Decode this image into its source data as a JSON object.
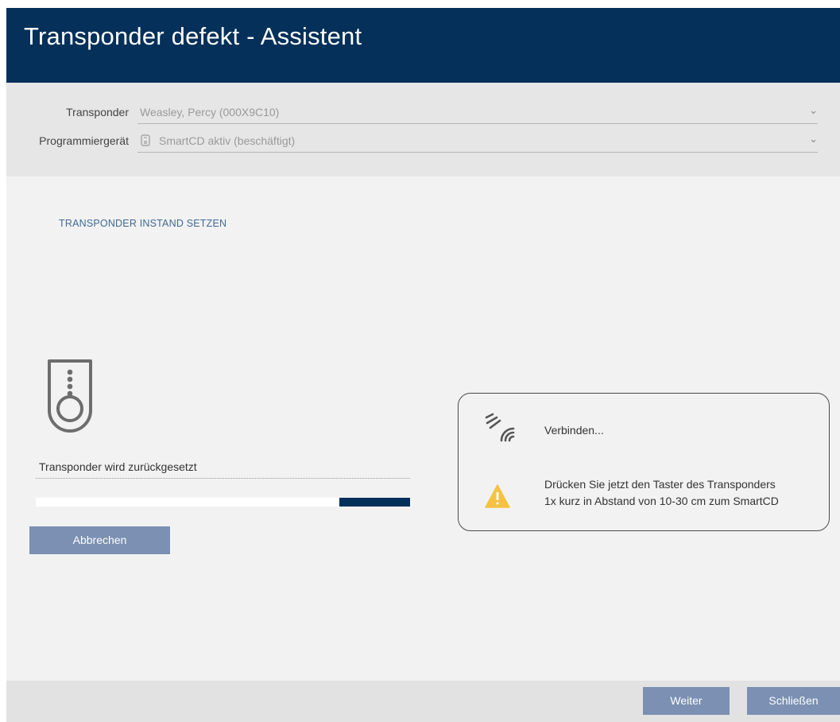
{
  "window": {
    "title": "Transponder defekt - Assistent"
  },
  "form": {
    "transponder": {
      "label": "Transponder",
      "value": "Weasley, Percy (000X9C10)"
    },
    "programmer": {
      "label": "Programmiergerät",
      "value": "SmartCD aktiv (beschäftigt)"
    }
  },
  "section": {
    "heading": "TRANSPONDER INSTAND SETZEN"
  },
  "status": {
    "text": "Transponder wird zurückgesetzt",
    "progress": 0.19
  },
  "buttons": {
    "cancel": "Abbrechen",
    "next": "Weiter",
    "close": "Schließen"
  },
  "info": {
    "connecting": "Verbinden...",
    "instruction_line1": "Drücken Sie jetzt den Taster des Transponders",
    "instruction_line2": "1x kurz in Abstand von 10-30 cm zum SmartCD"
  },
  "colors": {
    "titlebar": "#04305a",
    "button": "#7b90b2",
    "warning": "#f5c242",
    "heading": "#3e6a96"
  },
  "icons": {
    "transponder": "transponder-fob-icon",
    "device": "programmer-device-icon",
    "wireless": "wireless-signal-icon",
    "warning": "warning-triangle-icon",
    "dropdown": "chevron-down-icon"
  }
}
